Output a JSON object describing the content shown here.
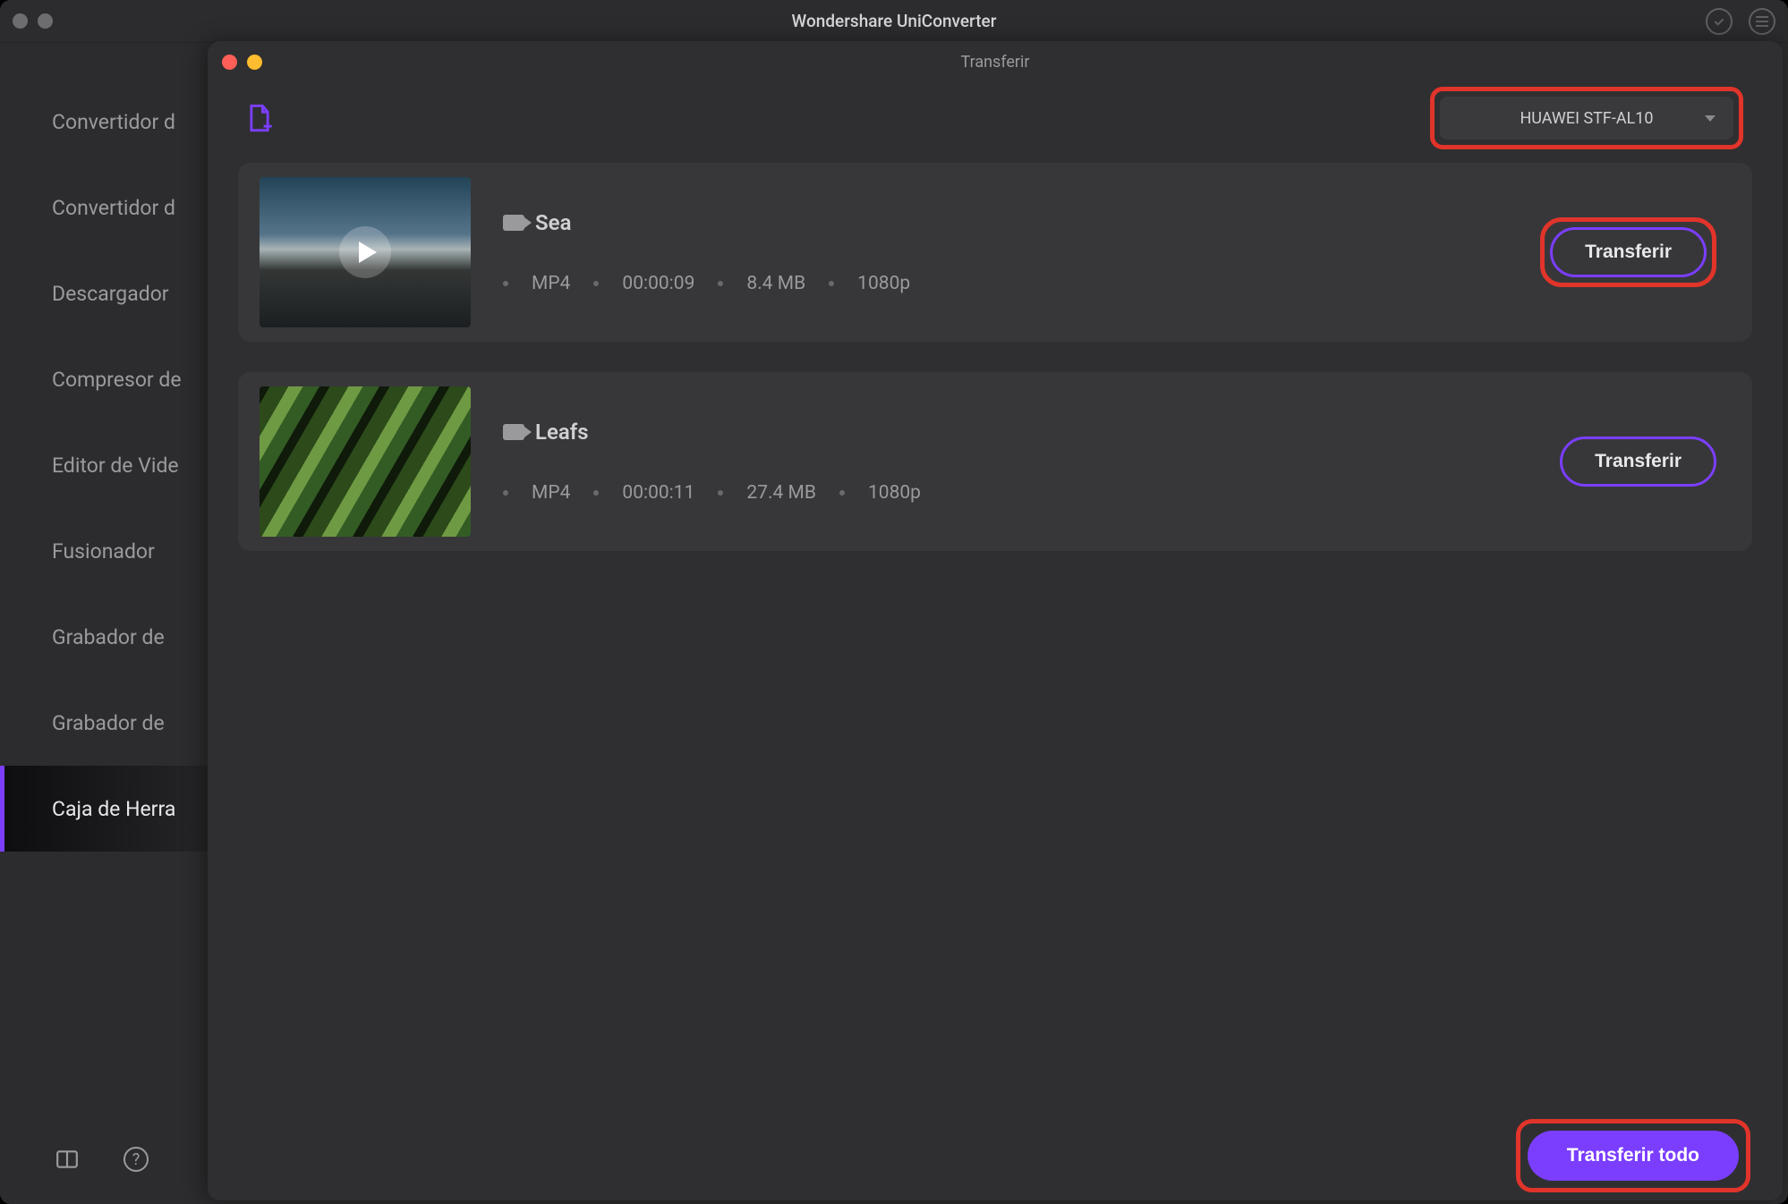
{
  "main": {
    "title": "Wondershare UniConverter"
  },
  "sidebar": {
    "items": [
      {
        "label": "Convertidor d"
      },
      {
        "label": "Convertidor d"
      },
      {
        "label": "Descargador"
      },
      {
        "label": "Compresor de"
      },
      {
        "label": "Editor de Vide"
      },
      {
        "label": "Fusionador"
      },
      {
        "label": "Grabador de"
      },
      {
        "label": "Grabador de"
      },
      {
        "label": "Caja de Herra",
        "active": true
      }
    ]
  },
  "modal": {
    "title": "Transferir",
    "device": "HUAWEI STF-AL10",
    "transfer_label": "Transferir",
    "transfer_all_label": "Transferir todo"
  },
  "items": [
    {
      "title": "Sea",
      "format": "MP4",
      "duration": "00:00:09",
      "size": "8.4 MB",
      "resolution": "1080p",
      "highlight": true
    },
    {
      "title": "Leafs",
      "format": "MP4",
      "duration": "00:00:11",
      "size": "27.4 MB",
      "resolution": "1080p",
      "highlight": false
    }
  ]
}
